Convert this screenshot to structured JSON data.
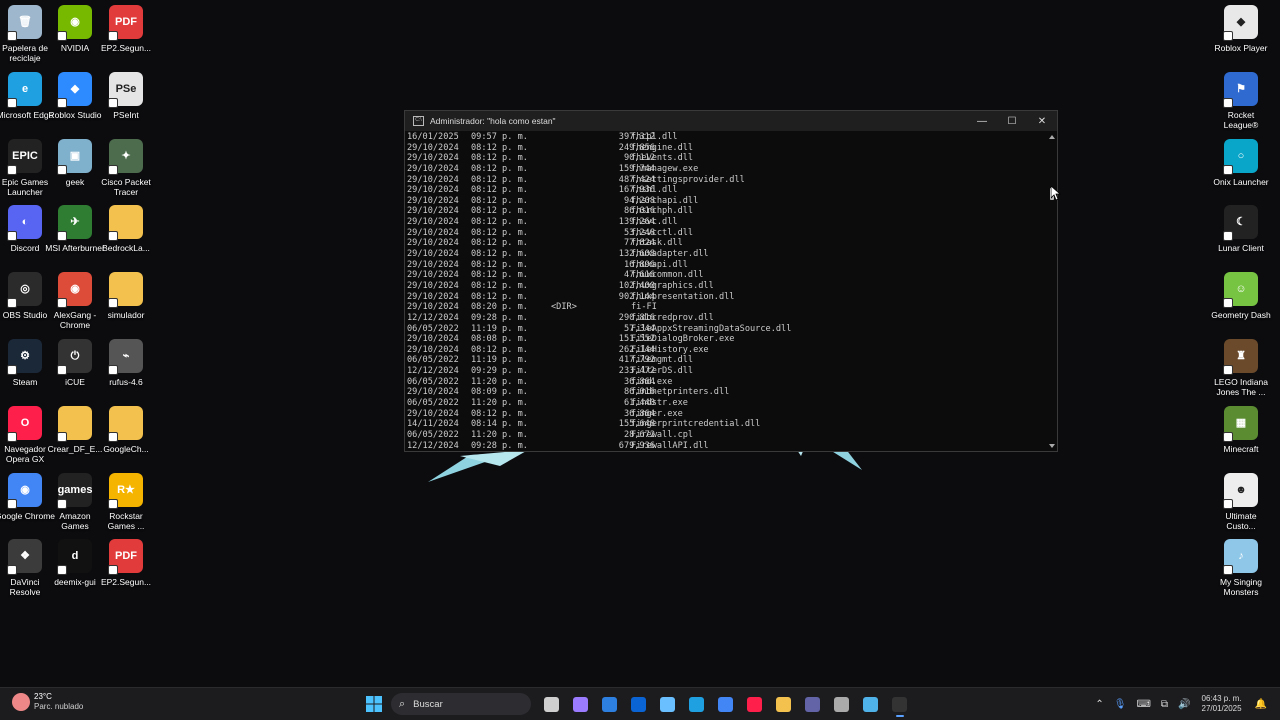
{
  "desktop": {
    "left_icons": [
      {
        "label": "Papelera de reciclaje",
        "icon": "recycle-bin-icon",
        "color": "#9fb7cc",
        "glyph": "🗑"
      },
      {
        "label": "NVIDIA",
        "icon": "nvidia-icon",
        "color": "#76b900",
        "glyph": "◉"
      },
      {
        "label": "EP2.Segun...",
        "icon": "pdf-icon",
        "color": "#e23b3b",
        "glyph": "PDF"
      },
      {
        "label": "Microsoft Edge",
        "icon": "edge-icon",
        "color": "#1fa0e0",
        "glyph": "e"
      },
      {
        "label": "Roblox Studio",
        "icon": "roblox-studio-icon",
        "color": "#2d8bff",
        "glyph": "◆"
      },
      {
        "label": "PSeInt",
        "icon": "pseint-icon",
        "color": "#e5e5e5",
        "glyph": "PSe"
      },
      {
        "label": "Epic Games Launcher",
        "icon": "epic-games-icon",
        "color": "#222222",
        "glyph": "EPIC"
      },
      {
        "label": "geek",
        "icon": "geek-icon",
        "color": "#7fb0cc",
        "glyph": "▣"
      },
      {
        "label": "Cisco Packet Tracer",
        "icon": "cisco-icon",
        "color": "#4d6b4d",
        "glyph": "✦"
      },
      {
        "label": "Discord",
        "icon": "discord-icon",
        "color": "#5865f2",
        "glyph": "◐"
      },
      {
        "label": "MSI Afterburner",
        "icon": "msi-afterburner-icon",
        "color": "#2e7d32",
        "glyph": "✈"
      },
      {
        "label": "BedrockLa...",
        "icon": "folder-icon",
        "color": "#f2c14e",
        "glyph": ""
      },
      {
        "label": "OBS Studio",
        "icon": "obs-icon",
        "color": "#2b2b2b",
        "glyph": "◎"
      },
      {
        "label": "AlexGang - Chrome",
        "icon": "chrome-icon",
        "color": "#dd4b39",
        "glyph": "◉"
      },
      {
        "label": "simulador",
        "icon": "folder-icon",
        "color": "#f2c14e",
        "glyph": ""
      },
      {
        "label": "Steam",
        "icon": "steam-icon",
        "color": "#1b2838",
        "glyph": "⚙"
      },
      {
        "label": "iCUE",
        "icon": "icue-icon",
        "color": "#333333",
        "glyph": "⏻"
      },
      {
        "label": "rufus-4.6",
        "icon": "usb-icon",
        "color": "#555555",
        "glyph": "⌁"
      },
      {
        "label": "Navegador Opera GX",
        "icon": "opera-gx-icon",
        "color": "#ff1f4b",
        "glyph": "O"
      },
      {
        "label": "Crear_DF_E...",
        "icon": "folder-icon",
        "color": "#f2c14e",
        "glyph": ""
      },
      {
        "label": "GoogleCh...",
        "icon": "folder-icon",
        "color": "#f2c14e",
        "glyph": ""
      },
      {
        "label": "Google Chrome",
        "icon": "chrome-icon",
        "color": "#4285f4",
        "glyph": "◉"
      },
      {
        "label": "Amazon Games",
        "icon": "amazon-games-icon",
        "color": "#222222",
        "glyph": "games"
      },
      {
        "label": "Rockstar Games ...",
        "icon": "rockstar-icon",
        "color": "#f5b400",
        "glyph": "R★"
      },
      {
        "label": "DaVinci Resolve",
        "icon": "davinci-icon",
        "color": "#3b3b3b",
        "glyph": "❖"
      },
      {
        "label": "deemix-gui",
        "icon": "deemix-icon",
        "color": "#111111",
        "glyph": "d"
      },
      {
        "label": "EP2.Segun...",
        "icon": "pdf-icon",
        "color": "#e23b3b",
        "glyph": "PDF"
      }
    ],
    "right_icons": [
      {
        "label": "Roblox Player",
        "icon": "roblox-icon",
        "color": "#e8e8e8",
        "glyph": "◆"
      },
      {
        "label": "Rocket League®",
        "icon": "rocket-league-icon",
        "color": "#2f6ad1",
        "glyph": "⚑"
      },
      {
        "label": "Onix Launcher",
        "icon": "onix-icon",
        "color": "#0aa6c9",
        "glyph": "○"
      },
      {
        "label": "Lunar Client",
        "icon": "lunar-client-icon",
        "color": "#222222",
        "glyph": "☾"
      },
      {
        "label": "Geometry Dash",
        "icon": "geometry-dash-icon",
        "color": "#76c442",
        "glyph": "☺"
      },
      {
        "label": "LEGO Indiana Jones  The ...",
        "icon": "lego-indiana-icon",
        "color": "#6a4a2a",
        "glyph": "♜"
      },
      {
        "label": "Minecraft",
        "icon": "minecraft-icon",
        "color": "#5b8c32",
        "glyph": "▦"
      },
      {
        "label": "Ultimate Custo...",
        "icon": "ultimate-custom-night-icon",
        "color": "#eeeeee",
        "glyph": "☻"
      },
      {
        "label": "My Singing Monsters",
        "icon": "my-singing-monsters-icon",
        "color": "#8ec7e8",
        "glyph": "♪"
      }
    ]
  },
  "console": {
    "title": "Administrador:  \"hola como estan\"",
    "rows": [
      {
        "date": "16/01/2025",
        "time": "09:57 p. m.",
        "dir": "",
        "size": "397,312",
        "name": "fhcpl.dll"
      },
      {
        "date": "29/10/2024",
        "time": "08:12 p. m.",
        "dir": "",
        "size": "249,856",
        "name": "fhengine.dll"
      },
      {
        "date": "29/10/2024",
        "time": "08:12 p. m.",
        "dir": "",
        "size": "90,112",
        "name": "fhevents.dll"
      },
      {
        "date": "29/10/2024",
        "time": "08:12 p. m.",
        "dir": "",
        "size": "159,744",
        "name": "fhmanagew.exe"
      },
      {
        "date": "29/10/2024",
        "time": "08:12 p. m.",
        "dir": "",
        "size": "487,424",
        "name": "fhsettingsprovider.dll"
      },
      {
        "date": "29/10/2024",
        "time": "08:12 p. m.",
        "dir": "",
        "size": "167,936",
        "name": "fhshl.dll"
      },
      {
        "date": "29/10/2024",
        "time": "08:12 p. m.",
        "dir": "",
        "size": "94,208",
        "name": "fhsrchapi.dll"
      },
      {
        "date": "29/10/2024",
        "time": "08:12 p. m.",
        "dir": "",
        "size": "86,016",
        "name": "fhsrchph.dll"
      },
      {
        "date": "29/10/2024",
        "time": "08:12 p. m.",
        "dir": "",
        "size": "139,264",
        "name": "fhsvc.dll"
      },
      {
        "date": "29/10/2024",
        "time": "08:12 p. m.",
        "dir": "",
        "size": "53,248",
        "name": "fhsvcctl.dll"
      },
      {
        "date": "29/10/2024",
        "time": "08:12 p. m.",
        "dir": "",
        "size": "77,824",
        "name": "fhtask.dll"
      },
      {
        "date": "29/10/2024",
        "time": "08:12 p. m.",
        "dir": "",
        "size": "132,608",
        "name": "fhuxadapter.dll"
      },
      {
        "date": "29/10/2024",
        "time": "08:12 p. m.",
        "dir": "",
        "size": "16,896",
        "name": "fhuxapi.dll"
      },
      {
        "date": "29/10/2024",
        "time": "08:12 p. m.",
        "dir": "",
        "size": "47,616",
        "name": "fhuxcommon.dll"
      },
      {
        "date": "29/10/2024",
        "time": "08:12 p. m.",
        "dir": "",
        "size": "102,400",
        "name": "fhuxgraphics.dll"
      },
      {
        "date": "29/10/2024",
        "time": "08:12 p. m.",
        "dir": "",
        "size": "902,144",
        "name": "fhuxpresentation.dll"
      },
      {
        "date": "29/10/2024",
        "time": "08:20 p. m.",
        "dir": "<DIR>",
        "size": "",
        "name": "fi-FI"
      },
      {
        "date": "12/12/2024",
        "time": "09:28 p. m.",
        "dir": "",
        "size": "290,816",
        "name": "fidocredprov.dll"
      },
      {
        "date": "06/05/2022",
        "time": "11:19 p. m.",
        "dir": "",
        "size": "57,344",
        "name": "FileAppxStreamingDataSource.dll"
      },
      {
        "date": "29/10/2024",
        "time": "08:08 p. m.",
        "dir": "",
        "size": "151,552",
        "name": "FileDialogBroker.exe"
      },
      {
        "date": "29/10/2024",
        "time": "08:12 p. m.",
        "dir": "",
        "size": "262,144",
        "name": "FileHistory.exe"
      },
      {
        "date": "06/05/2022",
        "time": "11:19 p. m.",
        "dir": "",
        "size": "417,792",
        "name": "filemgmt.dll"
      },
      {
        "date": "12/12/2024",
        "time": "09:29 p. m.",
        "dir": "",
        "size": "233,472",
        "name": "FilterDS.dll"
      },
      {
        "date": "06/05/2022",
        "time": "11:20 p. m.",
        "dir": "",
        "size": "36,864",
        "name": "find.exe"
      },
      {
        "date": "29/10/2024",
        "time": "08:09 p. m.",
        "dir": "",
        "size": "86,016",
        "name": "findnetprinters.dll"
      },
      {
        "date": "06/05/2022",
        "time": "11:20 p. m.",
        "dir": "",
        "size": "61,440",
        "name": "findstr.exe"
      },
      {
        "date": "29/10/2024",
        "time": "08:12 p. m.",
        "dir": "",
        "size": "36,864",
        "name": "finger.exe"
      },
      {
        "date": "14/11/2024",
        "time": "08:14 p. m.",
        "dir": "",
        "size": "155,648",
        "name": "fingerprintcredential.dll"
      },
      {
        "date": "06/05/2022",
        "time": "11:20 p. m.",
        "dir": "",
        "size": "28,672",
        "name": "Firewall.cpl"
      },
      {
        "date": "12/12/2024",
        "time": "09:28 p. m.",
        "dir": "",
        "size": "679,936",
        "name": "FirewallAPI.dll"
      }
    ]
  },
  "taskbar": {
    "weather_temp": "23°C",
    "weather_desc": "Parc. nublado",
    "search_placeholder": "Buscar",
    "apps": [
      {
        "icon": "task-view-icon",
        "color": "#cfcfcf"
      },
      {
        "icon": "copilot-icon",
        "color": "#9b7bff"
      },
      {
        "icon": "microsoft-store-icon",
        "color": "#2d7fe0"
      },
      {
        "icon": "outlook-icon",
        "color": "#0a64d4"
      },
      {
        "icon": "copilot-app-icon",
        "color": "#6ac0ff"
      },
      {
        "icon": "edge-icon",
        "color": "#1fa0e0"
      },
      {
        "icon": "chrome-icon",
        "color": "#4285f4"
      },
      {
        "icon": "opera-gx-icon",
        "color": "#ff1f4b"
      },
      {
        "icon": "file-explorer-icon",
        "color": "#f2c14e"
      },
      {
        "icon": "teams-icon",
        "color": "#6264a7"
      },
      {
        "icon": "settings-icon",
        "color": "#aaaaaa"
      },
      {
        "icon": "notepad-icon",
        "color": "#4fb2e8"
      },
      {
        "icon": "terminal-icon",
        "color": "#333333"
      }
    ],
    "time": "06:43 p. m.",
    "date": "27/01/2025"
  }
}
